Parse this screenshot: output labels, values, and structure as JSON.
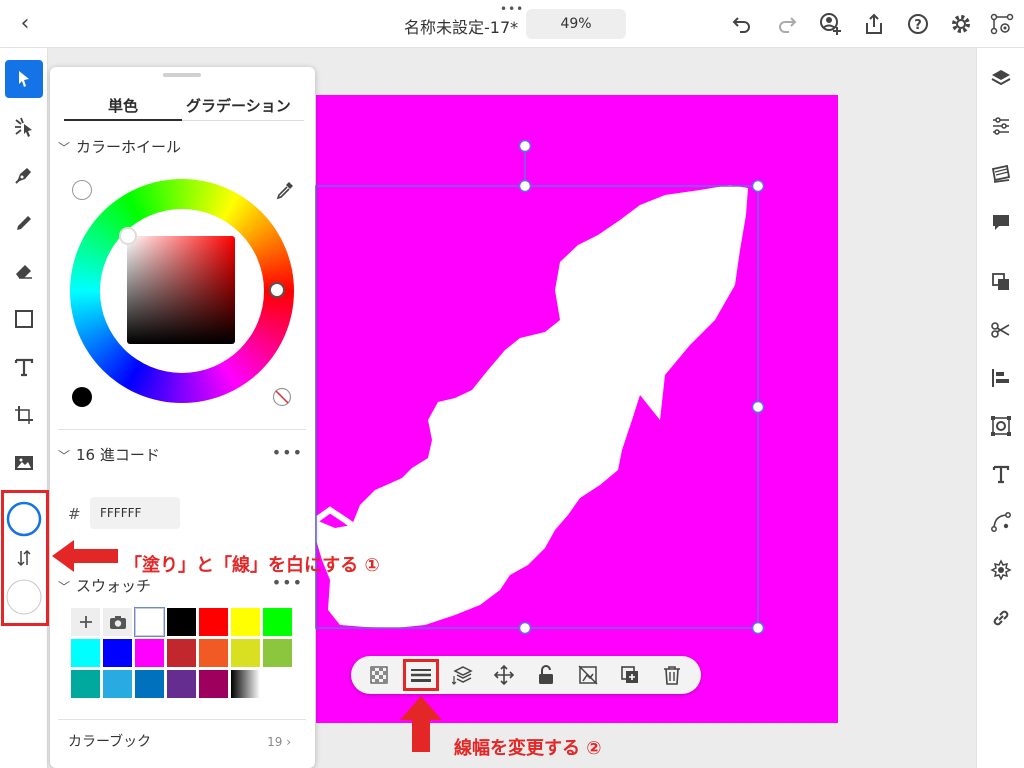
{
  "topbar": {
    "back_label": "‹",
    "more_label": "•••",
    "title": "名称未設定-17*",
    "zoom": "49%",
    "icons": [
      "undo-icon",
      "redo-icon",
      "invite-user-icon",
      "share-icon",
      "help-icon",
      "settings-icon",
      "preview-icon"
    ]
  },
  "left_tools": [
    "select-icon",
    "direct-select-icon",
    "pen-icon",
    "pencil-icon",
    "eraser-icon",
    "rectangle-icon",
    "type-icon",
    "transform-icon",
    "image-icon"
  ],
  "color_panel": {
    "tabs": [
      "単色",
      "グラデーション"
    ],
    "active_tab": 0,
    "wheel_section": "カラーホイール",
    "hex_section": "16 進コード",
    "hex_hash": "#",
    "hex_value": "FFFFFF",
    "swatch_section": "スウォッチ",
    "swatch_colors": [
      "#ffffff",
      "#000000",
      "#ff0000",
      "#ffff00",
      "#00ff00",
      "#00ffff",
      "#0000ff",
      "#ff00ff",
      "#c1272d",
      "#f15a24",
      "#d9e021",
      "#8cc63f",
      "#00a99d",
      "#29abe2",
      "#0071bc",
      "#662d91",
      "#9e005d"
    ],
    "color_book_label": "カラーブック",
    "color_book_count": "19",
    "more_label": "•••"
  },
  "right_tools": [
    "layers-icon",
    "properties-icon",
    "libraries-icon",
    "comments-icon",
    "pathfinder-icon",
    "scissors-icon",
    "align-icon",
    "repeat-icon",
    "text-properties-icon",
    "path-icon",
    "symbol-icon",
    "link-icon"
  ],
  "context_toolbar": [
    "opacity-icon",
    "stroke-weight-icon",
    "arrange-icon",
    "move-icon",
    "lock-icon",
    "clip-icon",
    "duplicate-icon",
    "delete-icon"
  ],
  "annotations": {
    "fill_stroke": "「塗り」と「線」を白にする ①",
    "stroke_width": "線幅を変更する ②"
  },
  "colors": {
    "accent": "#1473e6",
    "canvas": "#ff00ff",
    "annotation": "#e32727"
  }
}
